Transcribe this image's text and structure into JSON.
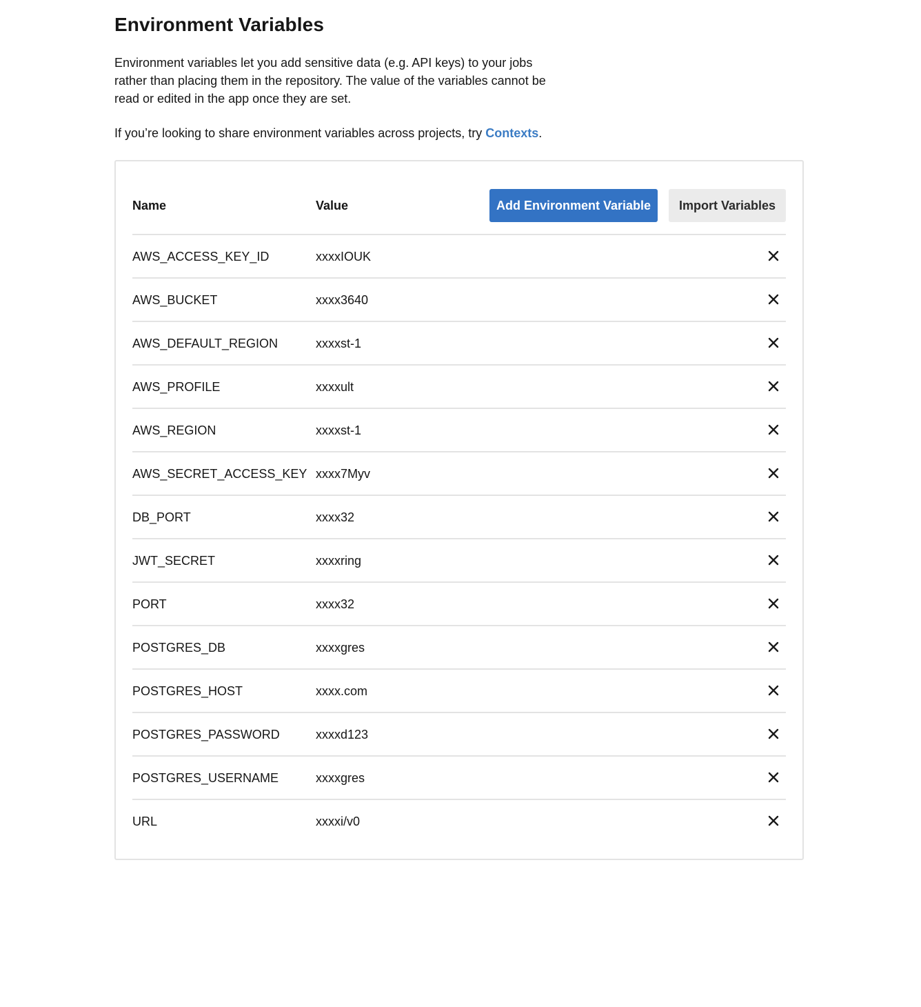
{
  "page": {
    "title": "Environment Variables",
    "description": "Environment variables let you add sensitive data (e.g. API keys) to your jobs rather than placing them in the repository. The value of the variables cannot be read or edited in the app once they are set.",
    "hint_prefix": "If you’re looking to share environment variables across projects, try ",
    "hint_link": "Contexts",
    "hint_suffix": "."
  },
  "table": {
    "headers": {
      "name": "Name",
      "value": "Value"
    },
    "actions": {
      "add_label": "Add Environment Variable",
      "import_label": "Import Variables"
    },
    "rows": [
      {
        "name": "AWS_ACCESS_KEY_ID",
        "value": "xxxxIOUK"
      },
      {
        "name": "AWS_BUCKET",
        "value": "xxxx3640"
      },
      {
        "name": "AWS_DEFAULT_REGION",
        "value": "xxxxst-1"
      },
      {
        "name": "AWS_PROFILE",
        "value": "xxxxult"
      },
      {
        "name": "AWS_REGION",
        "value": "xxxxst-1"
      },
      {
        "name": "AWS_SECRET_ACCESS_KEY",
        "value": "xxxx7Myv"
      },
      {
        "name": "DB_PORT",
        "value": "xxxx32"
      },
      {
        "name": "JWT_SECRET",
        "value": "xxxxring"
      },
      {
        "name": "PORT",
        "value": "xxxx32"
      },
      {
        "name": "POSTGRES_DB",
        "value": "xxxxgres"
      },
      {
        "name": "POSTGRES_HOST",
        "value": "xxxx.com"
      },
      {
        "name": "POSTGRES_PASSWORD",
        "value": "xxxxd123"
      },
      {
        "name": "POSTGRES_USERNAME",
        "value": "xxxxgres"
      },
      {
        "name": "URL",
        "value": "xxxxi/v0"
      }
    ],
    "row_action_icon": "close-icon"
  },
  "colors": {
    "link": "#3b7cc4",
    "primary_button": "#3373c4",
    "secondary_button": "#ebebeb",
    "divider": "#e3e3e3"
  }
}
